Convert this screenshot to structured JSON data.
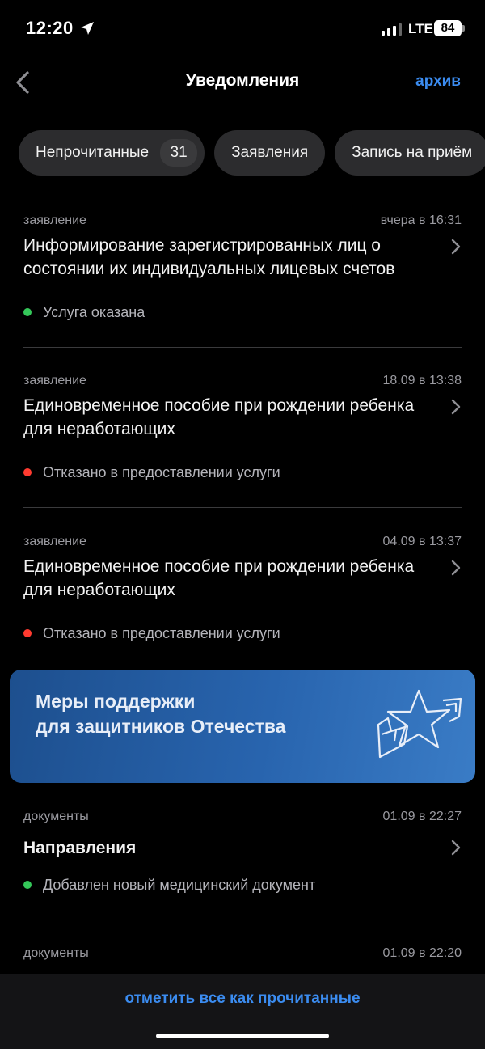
{
  "status_bar": {
    "time": "12:20",
    "network": "LTE",
    "battery": "84"
  },
  "nav": {
    "title": "Уведомления",
    "archive_label": "архив"
  },
  "filters": [
    {
      "label": "Непрочитанные",
      "count": "31"
    },
    {
      "label": "Заявления"
    },
    {
      "label": "Запись на приём"
    }
  ],
  "notifications": [
    {
      "category": "заявление",
      "time": "вчера в 16:31",
      "title": "Информирование зарегистрированных лиц о состоянии их индивидуальных лицевых счетов",
      "status": "Услуга оказана",
      "status_color": "#34c759"
    },
    {
      "category": "заявление",
      "time": "18.09 в 13:38",
      "title": "Единовременное пособие при рождении ребенка для неработающих",
      "status": "Отказано в предоставлении услуги",
      "status_color": "#ff3b30"
    },
    {
      "category": "заявление",
      "time": "04.09 в 13:37",
      "title": "Единовременное пособие при рождении ребенка для неработающих",
      "status": "Отказано в предоставлении услуги",
      "status_color": "#ff3b30"
    },
    {
      "category": "документы",
      "time": "01.09 в 22:27",
      "title": "Направления",
      "status": "Добавлен новый медицинский документ",
      "status_color": "#34c759"
    },
    {
      "category": "документы",
      "time": "01.09 в 22:20"
    }
  ],
  "banner": {
    "line1": "Меры поддержки",
    "line2": "для защитников Отечества"
  },
  "bottom": {
    "mark_all_label": "отметить все как прочитанные"
  },
  "colors": {
    "accent": "#3b8cf0",
    "success": "#34c759",
    "error": "#ff3b30"
  }
}
